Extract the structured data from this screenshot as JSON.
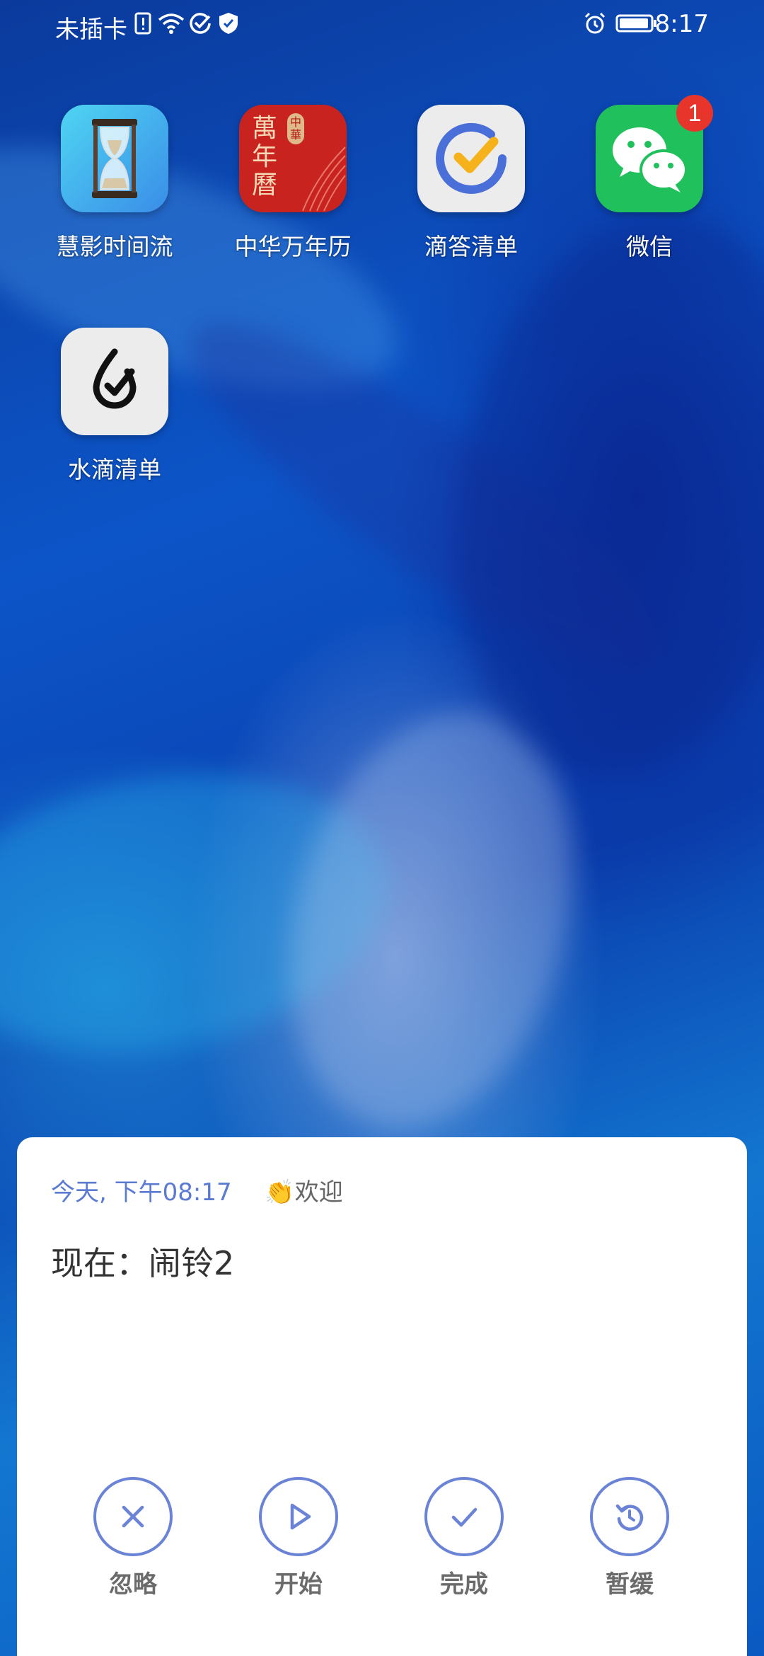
{
  "status_bar": {
    "carrier": "未插卡",
    "time": "8:17",
    "icons": [
      "sim-alert-icon",
      "wifi-icon",
      "check-circle-icon",
      "shield-icon",
      "alarm-icon",
      "battery-icon"
    ]
  },
  "apps": [
    {
      "label": "慧影时间流",
      "icon": "hourglass-icon"
    },
    {
      "label": "中华万年历",
      "icon": "calendar-icon",
      "icon_text": "萬年曆",
      "seal_text": "中華"
    },
    {
      "label": "滴答清单",
      "icon": "ticktick-icon"
    },
    {
      "label": "微信",
      "icon": "wechat-icon",
      "badge": "1"
    },
    {
      "label": "水滴清单",
      "icon": "water-drop-check-icon"
    }
  ],
  "notification": {
    "time": "今天, 下午08:17",
    "welcome_emoji": "👏",
    "welcome": "欢迎",
    "title": "现在：闹铃2",
    "actions": [
      {
        "label": "忽略",
        "icon": "close-icon"
      },
      {
        "label": "开始",
        "icon": "play-icon"
      },
      {
        "label": "完成",
        "icon": "check-icon"
      },
      {
        "label": "暂缓",
        "icon": "snooze-icon"
      }
    ]
  },
  "colors": {
    "accent": "#6a83d6",
    "badge": "#e8352b",
    "wechat_green": "#20c05c",
    "calendar_red": "#c8231f",
    "ticktick_blue": "#4a6fd9",
    "ticktick_yellow": "#f6b21b"
  }
}
